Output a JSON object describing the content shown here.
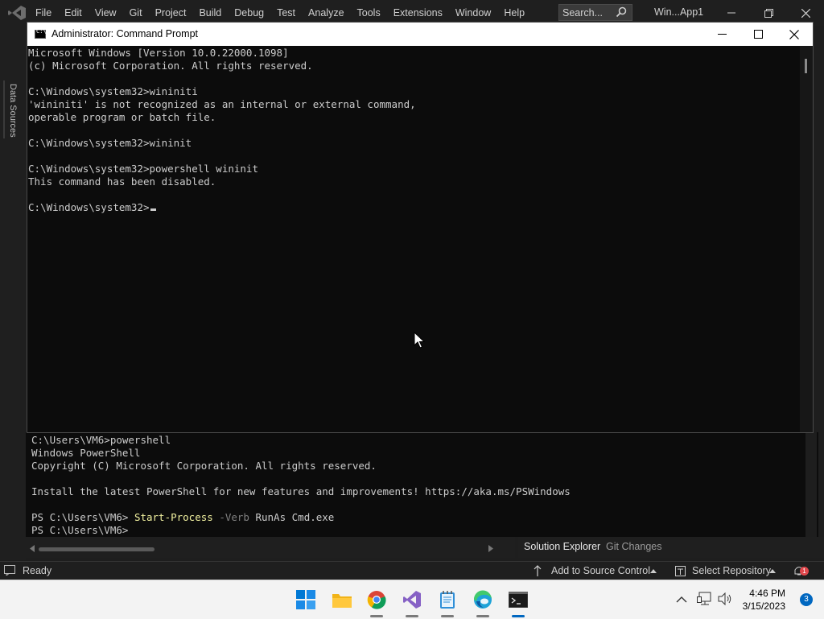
{
  "vs": {
    "menu": [
      "File",
      "Edit",
      "View",
      "Git",
      "Project",
      "Build",
      "Debug",
      "Test",
      "Analyze",
      "Tools",
      "Extensions",
      "Window",
      "Help"
    ],
    "search_placeholder": "Search...",
    "solution_name": "Win...App1",
    "left_strip_label": "Data Sources",
    "colors": {
      "background": "#1e1e1e",
      "chrome": "#1f1f1f",
      "accent": "#0067c0"
    }
  },
  "cmd": {
    "title": "Administrator: Command Prompt",
    "lines": [
      "Microsoft Windows [Version 10.0.22000.1098]",
      "(c) Microsoft Corporation. All rights reserved.",
      "",
      "C:\\Windows\\system32>wininiti",
      "'wininiti' is not recognized as an internal or external command,",
      "operable program or batch file.",
      "",
      "C:\\Windows\\system32>wininit",
      "",
      "C:\\Windows\\system32>powershell wininit",
      "This command has been disabled.",
      "",
      "C:\\Windows\\system32>"
    ]
  },
  "terminal": {
    "lines": [
      "C:\\Users\\VM6>powershell",
      "Windows PowerShell",
      "Copyright (C) Microsoft Corporation. All rights reserved.",
      "",
      "Install the latest PowerShell for new features and improvements! https://aka.ms/PSWindows",
      ""
    ],
    "prompt": "PS C:\\Users\\VM6> ",
    "cmd_name": "Start-Process",
    "cmd_param": "-Verb",
    "cmd_rest": "RunAs Cmd.exe",
    "last_prompt": "PS C:\\Users\\VM6>"
  },
  "tabs": {
    "solution_explorer": "Solution Explorer",
    "git_changes": "Git Changes"
  },
  "status": {
    "ready": "Ready",
    "add_source_control": "Add to Source Control",
    "select_repository": "Select Repository",
    "notification_count": "1"
  },
  "taskbar": {
    "apps": [
      "start-icon",
      "file-explorer-icon",
      "chrome-icon",
      "visual-studio-icon",
      "notepad-icon",
      "edge-icon",
      "command-prompt-icon"
    ],
    "time": "4:46 PM",
    "date": "3/15/2023",
    "notification_count": "3"
  }
}
